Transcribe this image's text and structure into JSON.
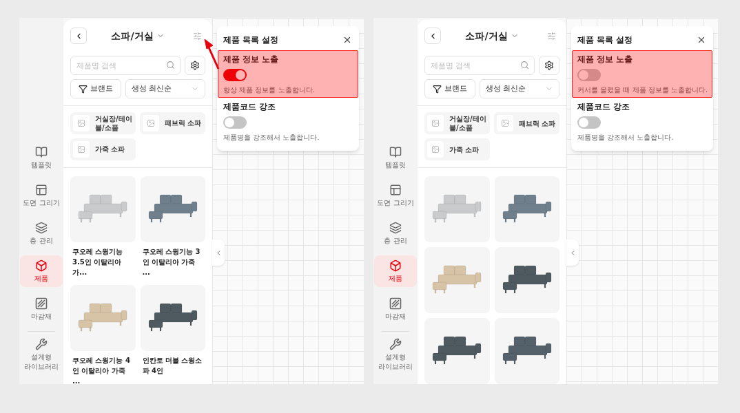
{
  "panes": [
    {
      "sidebar": {
        "items": [
          {
            "label": "템플릿",
            "kind": "book",
            "selected": false
          },
          {
            "label": "도면 그리기",
            "kind": "layout",
            "selected": false
          },
          {
            "label": "층 관리",
            "kind": "layers",
            "selected": false
          },
          {
            "label": "제품",
            "kind": "box",
            "selected": true
          },
          {
            "label": "마감재",
            "kind": "hatch",
            "selected": false
          },
          {
            "label": "설계형 라이브러리",
            "kind": "wrench",
            "selected": false
          }
        ]
      },
      "panel": {
        "title": "소파/거실",
        "search_placeholder": "제품명 검색",
        "brand_button": "브랜드",
        "sort": "생성 최신순",
        "categories": [
          "거실장/테이블/소품",
          "패브릭 소파",
          "가죽 소파"
        ],
        "products": [
          {
            "name": "쿠오레 스윙기능 3.5인 이탈리아 가...",
            "color": "#c9cacc"
          },
          {
            "name": "쿠오레 스윙기능 3인 이탈리아 가죽 ...",
            "color": "#6f7f8c"
          },
          {
            "name": "쿠오레 스윙기능 4인 이탈리아 가죽 ...",
            "color": "#d7c3a6"
          },
          {
            "name": "인칸토 더블 스윙소파 4인",
            "color": "#4f5a60"
          }
        ]
      },
      "settings": {
        "title": "제품 목록 설정",
        "options": [
          {
            "label": "제품 정보 노출",
            "on": true,
            "description": "항상 제품 정보를 노출합니다.",
            "highlighted": true
          },
          {
            "label": "제품코드 강조",
            "on": false,
            "description": "제품명을 강조해서 노출합니다.",
            "highlighted": false
          }
        ]
      },
      "annotation_arrow": true
    },
    {
      "sidebar": {
        "items": [
          {
            "label": "템플릿",
            "kind": "book",
            "selected": false
          },
          {
            "label": "도면 그리기",
            "kind": "layout",
            "selected": false
          },
          {
            "label": "층 관리",
            "kind": "layers",
            "selected": false
          },
          {
            "label": "제품",
            "kind": "box",
            "selected": true
          },
          {
            "label": "마감재",
            "kind": "hatch",
            "selected": false
          },
          {
            "label": "설계형 라이브러리",
            "kind": "wrench",
            "selected": false
          }
        ]
      },
      "panel": {
        "title": "소파/거실",
        "search_placeholder": "제품명 검색",
        "brand_button": "브랜드",
        "sort": "생성 최신순",
        "categories": [
          "거실장/테이블/소품",
          "패브릭 소파",
          "가죽 소파"
        ],
        "products": [
          {
            "color": "#c9cacc"
          },
          {
            "color": "#6f7f8c"
          },
          {
            "color": "#d7c3a6"
          },
          {
            "color": "#4f5a60"
          },
          {
            "color": "#4f5a60"
          },
          {
            "color": "#55616a"
          }
        ]
      },
      "settings": {
        "title": "제품 목록 설정",
        "options": [
          {
            "label": "제품 정보 노출",
            "on": false,
            "description": "커서를 올렸을 때 제품 정보를 노출합니다.",
            "highlighted": true
          },
          {
            "label": "제품코드 강조",
            "on": false,
            "description": "제품명을 강조해서 노출합니다.",
            "highlighted": false
          }
        ]
      }
    }
  ]
}
